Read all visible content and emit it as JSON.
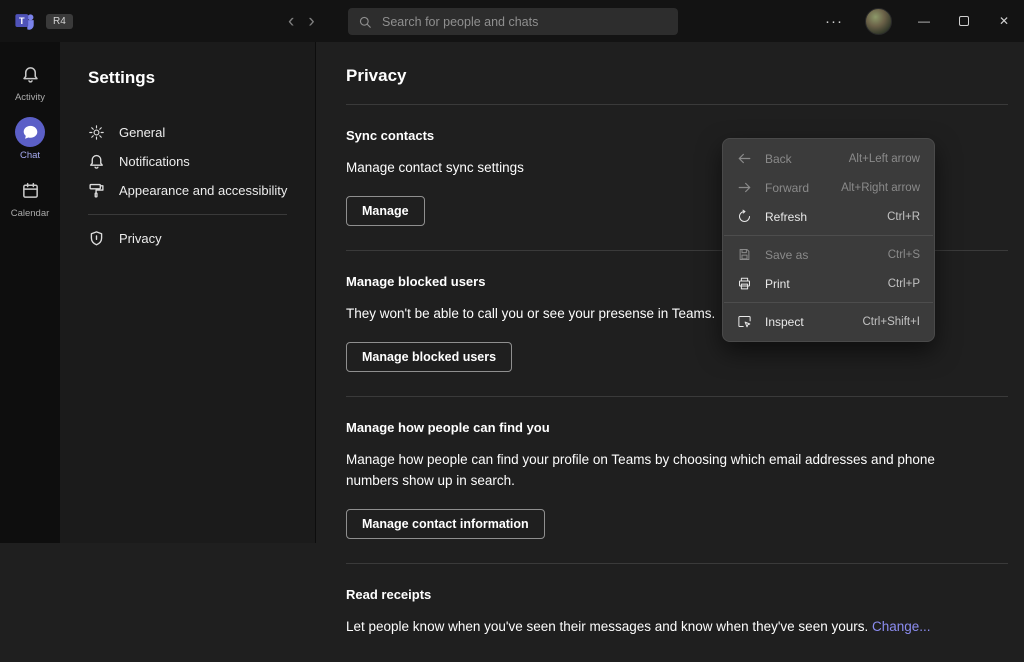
{
  "colors": {
    "accent": "#5b5fc7",
    "accent_text": "#a6abf2",
    "menu_bg": "#3b3b3b",
    "link": "#8b8cf0"
  },
  "titlebar": {
    "badge": "R4",
    "back_glyph": "‹",
    "forward_glyph": "›",
    "more_glyph": "···",
    "minimize_glyph": "—",
    "close_glyph": "✕",
    "search": {
      "placeholder": "Search for people and chats",
      "value": ""
    }
  },
  "rail": {
    "items": [
      {
        "label": "Activity",
        "icon": "bell-icon"
      },
      {
        "label": "Chat",
        "icon": "chat-icon",
        "active": true
      },
      {
        "label": "Calendar",
        "icon": "calendar-icon"
      }
    ]
  },
  "sidebar": {
    "title": "Settings",
    "items": [
      {
        "label": "General",
        "icon": "gear-icon"
      },
      {
        "label": "Notifications",
        "icon": "bell-icon"
      },
      {
        "label": "Appearance and accessibility",
        "icon": "paintbrush-icon"
      },
      {
        "label": "Privacy",
        "icon": "shield-icon"
      }
    ]
  },
  "main": {
    "title": "Privacy",
    "sections": [
      {
        "heading": "Sync contacts",
        "description": "Manage contact sync settings",
        "button": "Manage"
      },
      {
        "heading": "Manage blocked users",
        "description": "They won't be able to call you or see your presense in Teams.",
        "button": "Manage blocked users"
      },
      {
        "heading": "Manage how people can find you",
        "description": "Manage how people can find your profile on Teams by choosing which email addresses and phone numbers show up in search.",
        "button": "Manage contact information"
      },
      {
        "heading": "Read receipts",
        "description": "Let people know when you've seen their messages and know when they've seen yours. ",
        "link": "Change..."
      }
    ]
  },
  "context_menu": {
    "items": [
      {
        "label": "Back",
        "shortcut": "Alt+Left arrow",
        "icon": "arrow-left-icon",
        "disabled": true
      },
      {
        "label": "Forward",
        "shortcut": "Alt+Right arrow",
        "icon": "arrow-right-icon",
        "disabled": true
      },
      {
        "label": "Refresh",
        "shortcut": "Ctrl+R",
        "icon": "refresh-icon",
        "disabled": false
      },
      {
        "label": "Save as",
        "shortcut": "Ctrl+S",
        "icon": "save-icon",
        "disabled": true
      },
      {
        "label": "Print",
        "shortcut": "Ctrl+P",
        "icon": "printer-icon",
        "disabled": false
      },
      {
        "label": "Inspect",
        "shortcut": "Ctrl+Shift+I",
        "icon": "inspect-icon",
        "disabled": false
      }
    ]
  }
}
